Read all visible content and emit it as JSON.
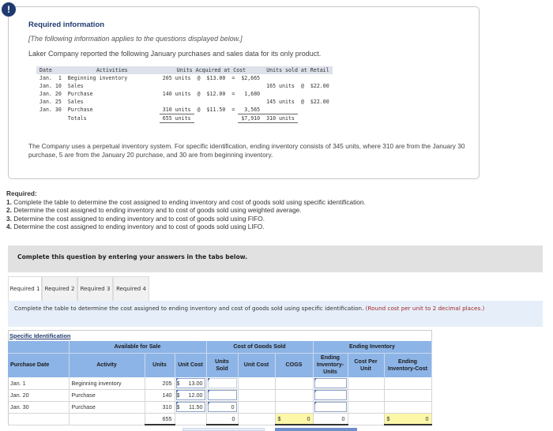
{
  "alert_icon": "!",
  "info": {
    "title": "Required information",
    "subtitle": "[The following information applies to the questions displayed below.]",
    "intro": "Laker Company reported the following January purchases and sales data for its only product.",
    "table": {
      "headers": [
        "Date",
        "Activities",
        "Units Acquired at Cost",
        "Units sold at Retail"
      ],
      "rows": [
        {
          "date": "Jan.  1",
          "activity": "Beginning inventory",
          "acq_units": "205 units",
          "acq_at": "@",
          "acq_cost": "$13.00",
          "acq_eq": "=",
          "acq_total": "$2,665",
          "sold_units": "",
          "sold_at": "",
          "sold_price": ""
        },
        {
          "date": "Jan. 10",
          "activity": "Sales",
          "acq_units": "",
          "acq_at": "",
          "acq_cost": "",
          "acq_eq": "",
          "acq_total": "",
          "sold_units": "165 units",
          "sold_at": "@",
          "sold_price": "$22.00"
        },
        {
          "date": "Jan. 20",
          "activity": "Purchase",
          "acq_units": "140 units",
          "acq_at": "@",
          "acq_cost": "$12.00",
          "acq_eq": "=",
          "acq_total": "1,680",
          "sold_units": "",
          "sold_at": "",
          "sold_price": ""
        },
        {
          "date": "Jan. 25",
          "activity": "Sales",
          "acq_units": "",
          "acq_at": "",
          "acq_cost": "",
          "acq_eq": "",
          "acq_total": "",
          "sold_units": "145 units",
          "sold_at": "@",
          "sold_price": "$22.00"
        },
        {
          "date": "Jan. 30",
          "activity": "Purchase",
          "acq_units": "310 units",
          "acq_at": "@",
          "acq_cost": "$11.50",
          "acq_eq": "=",
          "acq_total": "3,565",
          "sold_units": "",
          "sold_at": "",
          "sold_price": ""
        }
      ],
      "totals": {
        "label": "Totals",
        "acq_units": "655 units",
        "acq_total": "$7,910",
        "sold_units": "310 units"
      }
    },
    "note": "The Company uses a perpetual inventory system. For specific identification, ending inventory consists of 345 units, where 310 are from the January 30 purchase, 5 are from the January 20 purchase, and 30 are from beginning inventory."
  },
  "required": {
    "heading": "Required:",
    "items": [
      {
        "num": "1.",
        "text": "Complete the table to determine the cost assigned to ending inventory and cost of goods sold using specific identification."
      },
      {
        "num": "2.",
        "text": "Determine the cost assigned to ending inventory and to cost of goods sold using weighted average."
      },
      {
        "num": "3.",
        "text": "Determine the cost assigned to ending inventory and to cost of goods sold using FIFO."
      },
      {
        "num": "4.",
        "text": "Determine the cost assigned to ending inventory and to cost of goods sold using LIFO."
      }
    ]
  },
  "instruction_bar": "Complete this question by entering your answers in the tabs below.",
  "tabs": [
    {
      "label": "Required 1",
      "active": true
    },
    {
      "label": "Required 2",
      "active": false
    },
    {
      "label": "Required 3",
      "active": false
    },
    {
      "label": "Required 4",
      "active": false
    }
  ],
  "tab_instruction": {
    "text": "Complete the table to determine the cost assigned to ending inventory and cost of goods sold using specific identification.",
    "hint": "(Round cost per unit to 2 decimal places.)"
  },
  "si_table": {
    "title": "Specific Identification",
    "group_headers": {
      "available": "Available for Sale",
      "cogs": "Cost of Goods Sold",
      "ending": "Ending Inventory"
    },
    "col_headers": {
      "purchase_date": "Purchase Date",
      "activity": "Activity",
      "units": "Units",
      "unit_cost": "Unit Cost",
      "units_sold": "Units Sold",
      "cogs_unit_cost": "Unit Cost",
      "cogs": "COGS",
      "ei_units": "Ending Inventory-Units",
      "cost_per_unit": "Cost Per Unit",
      "ei_cost": "Ending Inventory-Cost"
    },
    "rows": [
      {
        "date": "Jan. 1",
        "activity": "Beginning inventory",
        "units": "205",
        "cost_sym": "$",
        "unit_cost": "13.00",
        "units_sold": "",
        "ei_units": ""
      },
      {
        "date": "Jan. 20",
        "activity": "Purchase",
        "units": "140",
        "cost_sym": "$",
        "unit_cost": "12.00",
        "units_sold": "",
        "ei_units": ""
      },
      {
        "date": "Jan. 30",
        "activity": "Purchase",
        "units": "310",
        "cost_sym": "$",
        "unit_cost": "11.50",
        "units_sold": "0",
        "ei_units": ""
      }
    ],
    "totals": {
      "units": "655",
      "units_sold": "0",
      "cogs_sym": "$",
      "cogs": "0",
      "ei_units": "0",
      "ei_cost_sym": "$",
      "ei_cost": "0"
    }
  }
}
